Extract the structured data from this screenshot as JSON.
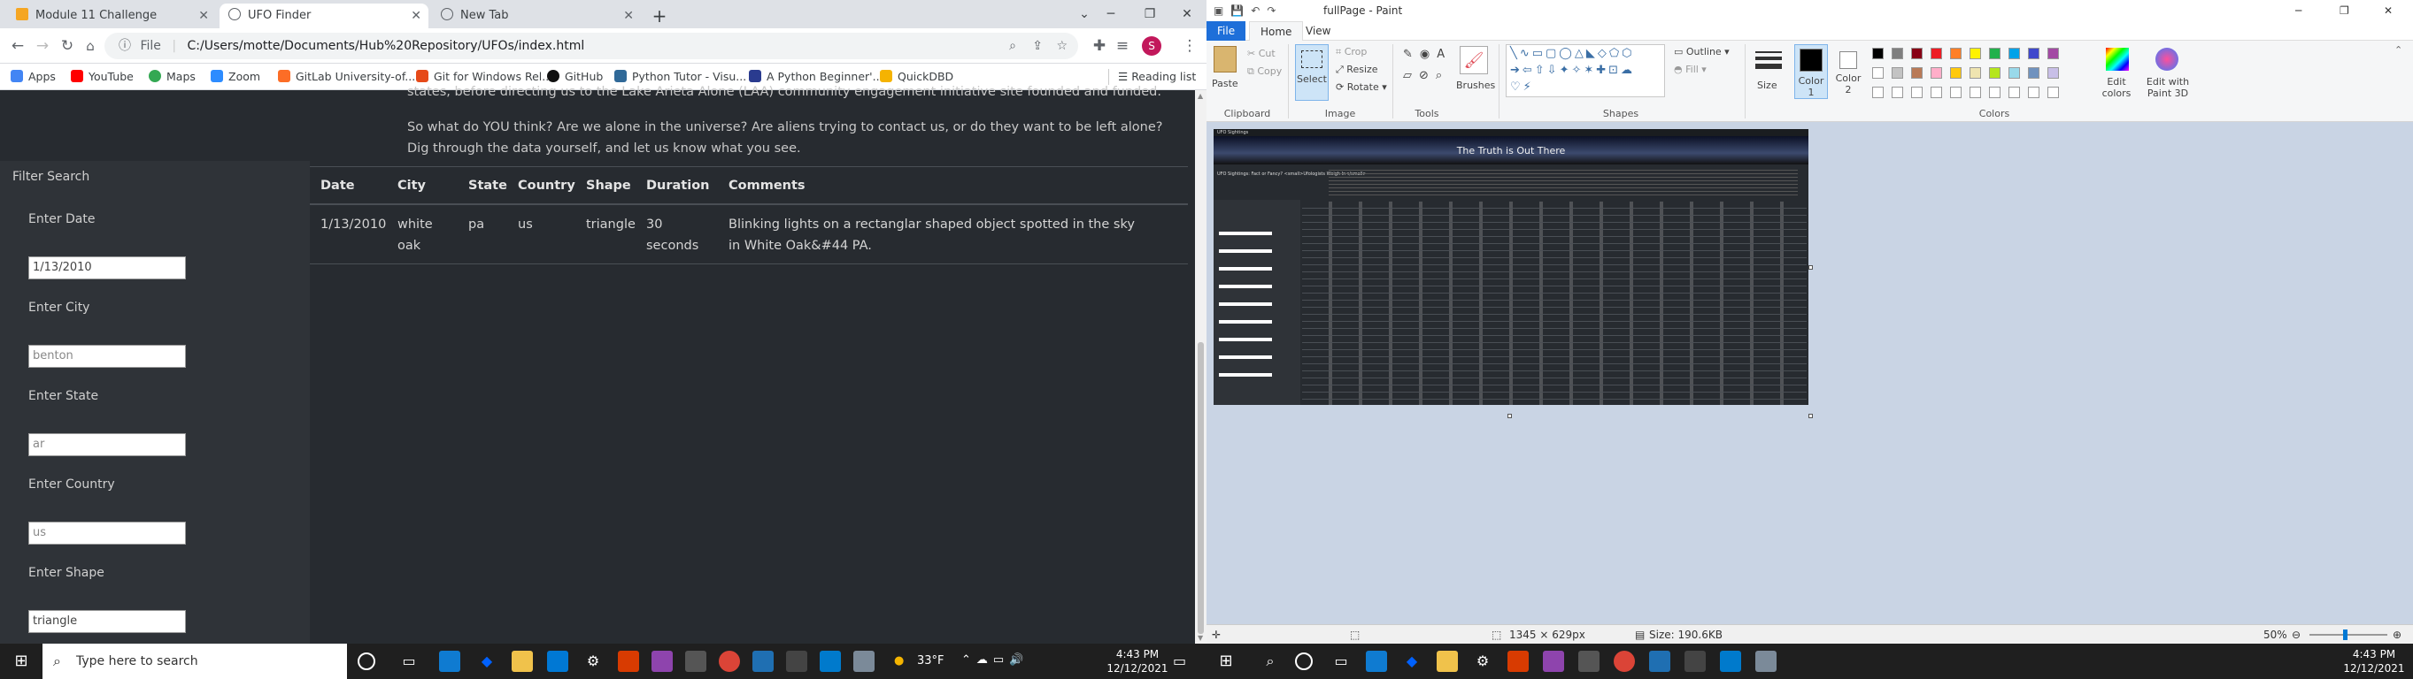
{
  "browser": {
    "tabs": [
      {
        "title": "Module 11 Challenge"
      },
      {
        "title": "UFO Finder"
      },
      {
        "title": "New Tab"
      }
    ],
    "address_prefix": "File",
    "address": "C:/Users/motte/Documents/Hub%20Repository/UFOs/index.html",
    "bookmarks": [
      "Apps",
      "YouTube",
      "Maps",
      "Zoom",
      "GitLab University-of...",
      "Git for Windows Rel...",
      "GitHub",
      "Python Tutor - Visu...",
      "A Python Beginner'...",
      "QuickDBD"
    ],
    "reading_list": "Reading list",
    "profile_initial": "S"
  },
  "page": {
    "para1_tail": "states, before directing us to the Lake Arieta Alone (LAA) community engagement initiative site founded and funded.",
    "para2": "So what do YOU think? Are we alone in the universe? Are aliens trying to contact us, or do they want to be left alone? Dig through the data yourself, and let us know what you see.",
    "filter_title": "Filter Search",
    "filters": [
      {
        "label": "Enter Date",
        "value": "1/13/2010",
        "placeholder": false
      },
      {
        "label": "Enter City",
        "value": "benton",
        "placeholder": true
      },
      {
        "label": "Enter State",
        "value": "ar",
        "placeholder": true
      },
      {
        "label": "Enter Country",
        "value": "us",
        "placeholder": true
      },
      {
        "label": "Enter Shape",
        "value": "triangle",
        "placeholder": false
      }
    ],
    "table": {
      "headers": [
        "Date",
        "City",
        "State",
        "Country",
        "Shape",
        "Duration",
        "Comments"
      ],
      "row": {
        "date": "1/13/2010",
        "city": "white oak",
        "state": "pa",
        "country": "us",
        "shape": "triangle",
        "duration": "30 seconds",
        "comments": "Blinking lights on a rectanglar shaped object spotted in the sky in White Oak&#44 PA."
      }
    }
  },
  "taskbar_left": {
    "search_placeholder": "Type here to search",
    "weather": "33°F",
    "time": "4:43 PM",
    "date": "12/12/2021"
  },
  "paint": {
    "title": "fullPage - Paint",
    "menu": [
      "File",
      "Home",
      "View"
    ],
    "ribbon": {
      "paste": "Paste",
      "cut": "Cut",
      "copy": "Copy",
      "select": "Select",
      "crop": "Crop",
      "resize": "Resize",
      "rotate": "Rotate",
      "brushes": "Brushes",
      "outline": "Outline",
      "fill": "Fill",
      "size": "Size",
      "color1": "Color 1",
      "color2": "Color 2",
      "edit_colors": "Edit colors",
      "edit_3d": "Edit with Paint 3D",
      "groups": [
        "Clipboard",
        "Image",
        "Tools",
        "Shapes",
        "Colors"
      ]
    },
    "palette": [
      "#000000",
      "#7f7f7f",
      "#880015",
      "#ed1c24",
      "#ff7f27",
      "#fff200",
      "#22b14c",
      "#00a2e8",
      "#3f48cc",
      "#a349a4",
      "#ffffff",
      "#c3c3c3",
      "#b97a57",
      "#ffaec9",
      "#ffc90e",
      "#efe4b0",
      "#b5e61d",
      "#99d9ea",
      "#7092be",
      "#c8bfe7"
    ],
    "status": {
      "dimensions": "1345 × 629px",
      "size": "Size: 190.6KB",
      "zoom": "50%"
    },
    "thumb": {
      "tab": "UFO Sightings",
      "banner": "The Truth is Out There",
      "heading": "UFO Sightings: Fact or Fancy?",
      "heading_small": "<small>Ufologists Weigh In</small>"
    }
  },
  "taskbar_right": {
    "time": "4:43 PM",
    "date": "12/12/2021"
  }
}
